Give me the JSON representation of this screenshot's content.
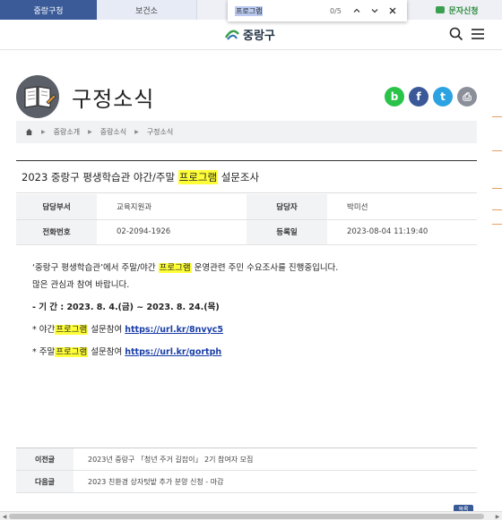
{
  "top_tabs": [
    {
      "label": "중랑구청"
    },
    {
      "label": "보건소"
    },
    {
      "label": ""
    },
    {
      "label": "문자신청"
    }
  ],
  "find_bar": {
    "query": "프로그램",
    "count": "0/5",
    "prev_icon": "chevron-up-icon",
    "next_icon": "chevron-down-icon",
    "close_icon": "close-icon"
  },
  "header": {
    "logo_text": "중랑구",
    "search_icon": "search-icon",
    "menu_icon": "menu-icon"
  },
  "page": {
    "heading": "구정소식",
    "share": [
      {
        "name": "band-share",
        "glyph": "b",
        "color": "#2ac34a"
      },
      {
        "name": "facebook-share",
        "glyph": "f",
        "color": "#3b5998"
      },
      {
        "name": "twitter-share",
        "glyph": "t",
        "color": "#2ba3e2"
      },
      {
        "name": "print",
        "glyph": "⎙",
        "color": "#8a8f99"
      }
    ]
  },
  "breadcrumb": {
    "home_icon": "home-icon",
    "items": [
      "중랑소개",
      "중랑소식",
      "구정소식"
    ]
  },
  "post": {
    "title_before": "2023 중랑구 평생학습관 야간/주말 ",
    "title_highlight": "프로그램",
    "title_after": " 설문조사",
    "info": {
      "dept_label": "담당부서",
      "dept_value": "교육지원과",
      "manager_label": "담당자",
      "manager_value": "박미선",
      "phone_label": "전화번호",
      "phone_value": "02-2094-1926",
      "date_label": "등록일",
      "date_value": "2023-08-04 11:19:40"
    },
    "body": {
      "line1_before": "‘중랑구 평생학습관’에서 주말/야간 ",
      "line1_highlight": "프로그램",
      "line1_after": " 운영관련 주민 수요조사를 진행중입니다.",
      "line2": "많은 관심과 참여 바랍니다.",
      "period": "- 기 간 : 2023. 8. 4.(금) ~ 2023. 8. 24.(목)",
      "night_before": "* 야간",
      "night_highlight": "프로그램",
      "night_after": " 설문참여 ",
      "night_link": "https://url.kr/8nvyc5",
      "weekend_before": "* 주말",
      "weekend_highlight": "프로그램",
      "weekend_after": " 설문참여 ",
      "weekend_link": "https://url.kr/gortph"
    }
  },
  "nav": {
    "prev_label": "이전글",
    "prev_title": "2023년 중랑구 「청년 주거 길잡이」 2기 참여자 모집",
    "next_label": "다음글",
    "next_title": "2023 친환경 상자텃밭 추가 분양 신청 - 마감"
  },
  "top_button": "목록",
  "colors": {
    "accent": "#3a5a98",
    "highlight": "#ffff38",
    "link": "#1a3ea8"
  }
}
